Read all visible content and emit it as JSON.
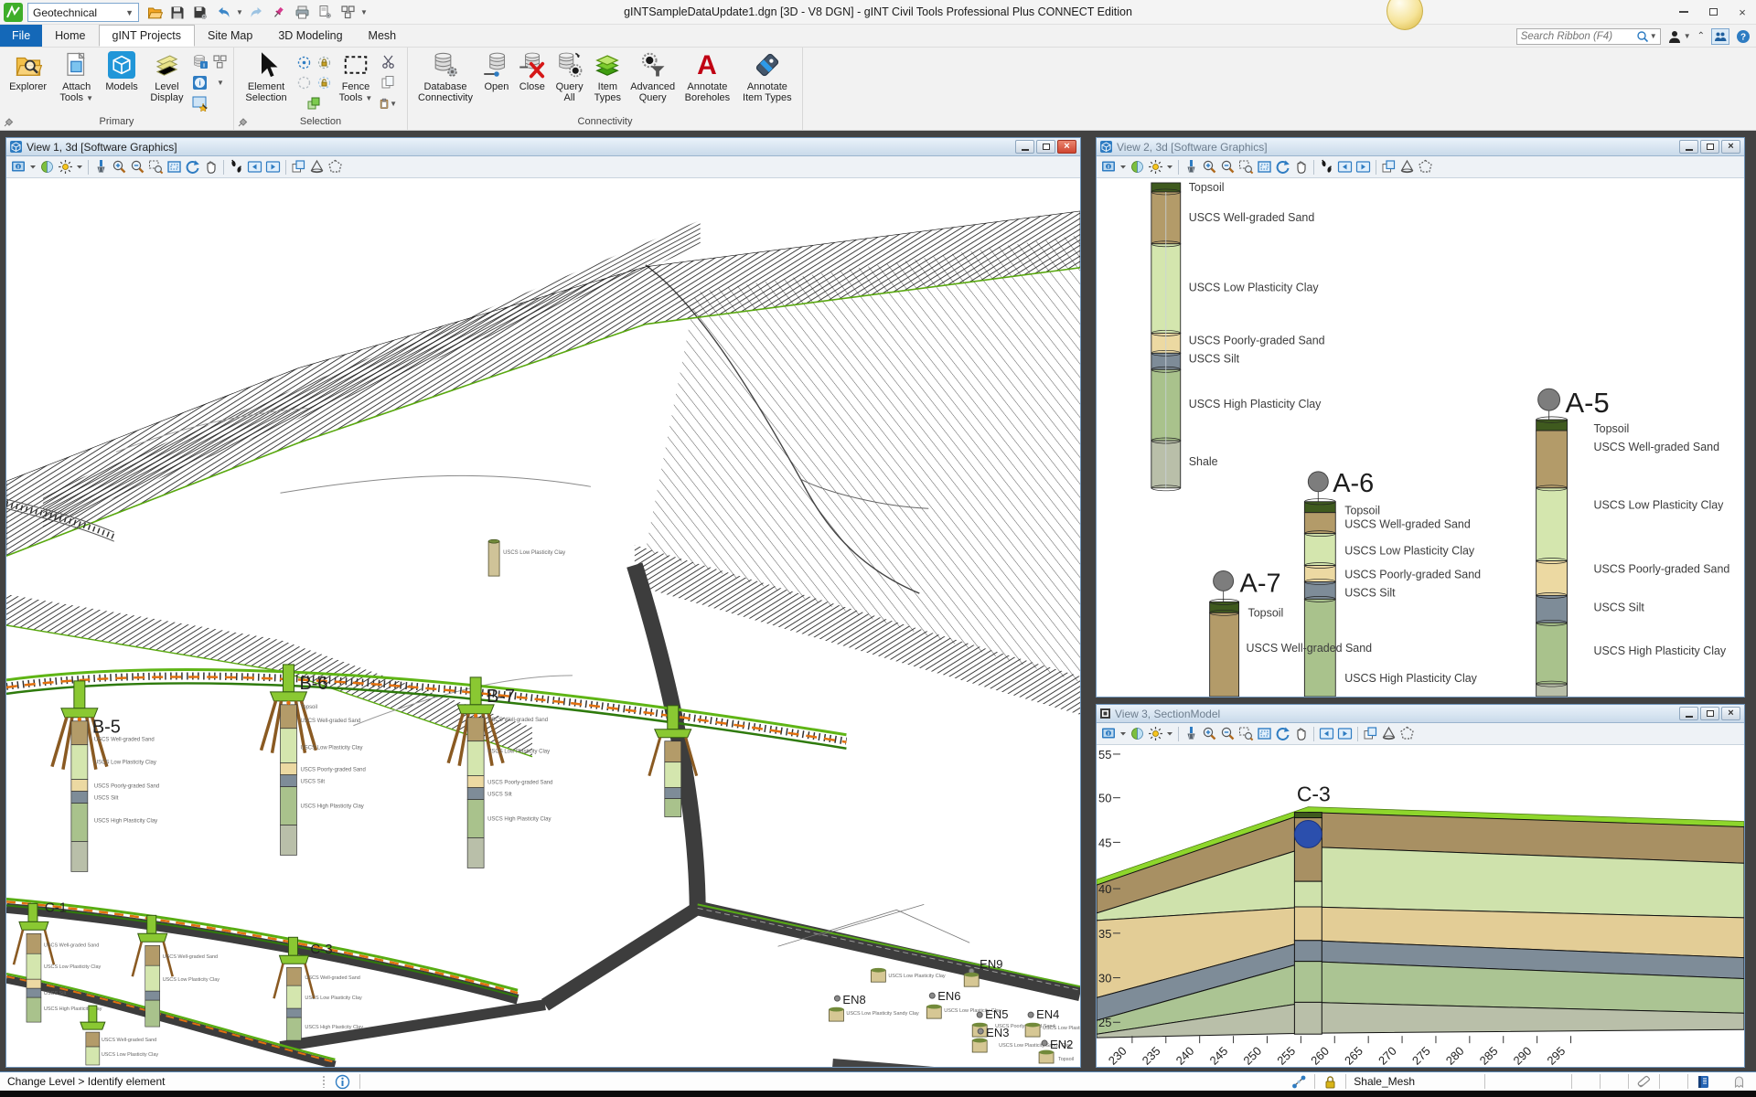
{
  "titlebar": {
    "workspace": "Geotechnical",
    "title": "gINTSampleDataUpdate1.dgn [3D - V8 DGN] - gINT Civil Tools Professional Plus CONNECT Edition"
  },
  "tab_bar": {
    "tabs": [
      "File",
      "Home",
      "gINT Projects",
      "Site Map",
      "3D Modeling",
      "Mesh"
    ],
    "active_tab": "gINT Projects",
    "search_placeholder": "Search Ribbon (F4)"
  },
  "ribbon": {
    "group_labels": [
      "Primary",
      "Selection",
      "Connectivity"
    ],
    "buttons": {
      "explorer": "Explorer",
      "attach_tools": "Attach Tools",
      "models": "Models",
      "level_display": "Level Display",
      "element_selection": "Element Selection",
      "fence_tools": "Fence Tools",
      "database_connectivity": "Database Connectivity",
      "open": "Open",
      "close": "Close",
      "query_all": "Query All",
      "item_types": "Item Types",
      "advanced_query": "Advanced Query",
      "annotate_boreholes": "Annotate Boreholes",
      "annotate_item_types": "Annotate Item Types"
    }
  },
  "view_toolbar": [
    "view-attributes",
    "chevron-down",
    "display-style",
    "brightness",
    "chevron-down",
    "separator",
    "update-view",
    "zoom-in",
    "zoom-out",
    "window-area",
    "fit-view",
    "rotate-view",
    "pan-view",
    "separator",
    "walk",
    "view-previous",
    "view-next",
    "separator",
    "copy-view",
    "clip-volume",
    "clip-mask"
  ],
  "views": {
    "view1": {
      "title": "View 1, 3d [Software Graphics]",
      "pier_labels": [
        "B-5",
        "B-6",
        "B-7"
      ],
      "section_labels": [
        "C-1",
        "C-3"
      ],
      "en_labels": [
        "EN2",
        "EN3",
        "EN4",
        "EN5",
        "EN6",
        "EN8",
        "EN9"
      ]
    },
    "view2": {
      "title": "View 2, 3d [Software Graphics]",
      "boreholes": [
        "A-5",
        "A-6",
        "A-7"
      ],
      "strata": [
        "Topsoil",
        "USCS Well-graded Sand",
        "USCS Low Plasticity Clay",
        "USCS Poorly-graded Sand",
        "USCS Silt",
        "USCS High Plasticity Clay",
        "Shale"
      ]
    },
    "view3": {
      "title": "View 3, SectionModel",
      "borehole": "C-3",
      "y_ticks": [
        "55",
        "50",
        "45",
        "40",
        "35",
        "30",
        "25"
      ],
      "x_ticks": [
        "230",
        "235",
        "240",
        "245",
        "250",
        "255",
        "260",
        "265",
        "270",
        "275",
        "280",
        "285",
        "290",
        "295"
      ]
    }
  },
  "annotations": [
    "Topsoil",
    "USCS Well-graded Sand",
    "USCS Low Plasticity Clay",
    "USCS Poorly-graded Sand",
    "USCS Silt",
    "USCS High Plasticity Clay",
    "Shale",
    "USCS Low Plasticity Sandy Clay"
  ],
  "statusbar": {
    "prompt": "Change Level > Identify element",
    "active_item": "Shale_Mesh"
  },
  "colors": {
    "accent_blue": "#2e7cc2",
    "file_tab_blue": "#1468b8",
    "topsoil": "#3f5a1e",
    "well_graded_sand": "#b39b69",
    "low_plasticity_clay": "#d4e6ae",
    "poorly_graded_sand": "#ecd9a2",
    "silt": "#7e8c98",
    "high_plasticity_clay": "#a9c28c",
    "shale": "#b9bfa9",
    "surface_lime": "#8ed62c",
    "marker_blue": "#2b4fad"
  }
}
